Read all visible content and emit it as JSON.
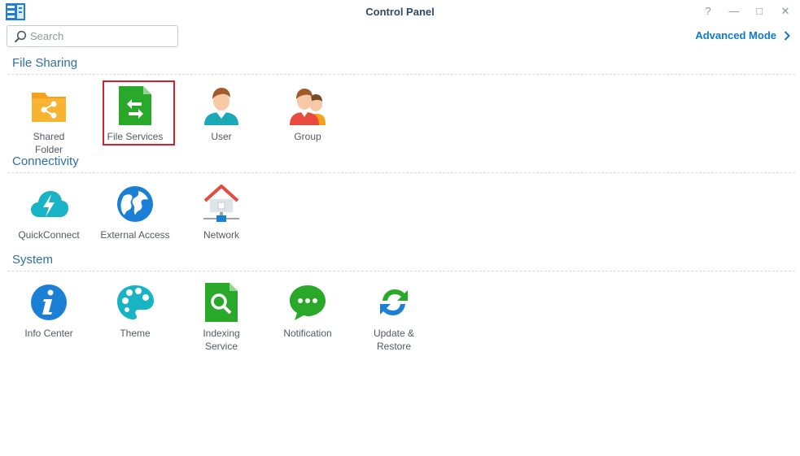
{
  "window": {
    "title": "Control Panel",
    "help_glyph": "?",
    "minimize_glyph": "—",
    "maximize_glyph": "□",
    "close_glyph": "✕"
  },
  "toolbar": {
    "search_placeholder": "Search",
    "search_value": "",
    "advanced_mode_label": "Advanced Mode"
  },
  "sections": [
    {
      "title": "File Sharing",
      "items": [
        {
          "label": "Shared\nFolder",
          "icon": "shared-folder-icon"
        },
        {
          "label": "File Services",
          "icon": "file-services-icon",
          "highlighted": true
        },
        {
          "label": "User",
          "icon": "user-icon"
        },
        {
          "label": "Group",
          "icon": "group-icon"
        }
      ]
    },
    {
      "title": "Connectivity",
      "items": [
        {
          "label": "QuickConnect",
          "icon": "quickconnect-icon"
        },
        {
          "label": "External Access",
          "icon": "external-access-icon"
        },
        {
          "label": "Network",
          "icon": "network-icon"
        }
      ]
    },
    {
      "title": "System",
      "items": [
        {
          "label": "Info Center",
          "icon": "info-center-icon"
        },
        {
          "label": "Theme",
          "icon": "theme-icon"
        },
        {
          "label": "Indexing\nService",
          "icon": "indexing-service-icon"
        },
        {
          "label": "Notification",
          "icon": "notification-icon"
        },
        {
          "label": "Update &\nRestore",
          "icon": "update-restore-icon"
        }
      ]
    }
  ],
  "colors": {
    "accent": "#0d7ad1",
    "section_title": "#2f70a4",
    "highlight_border": "#d6212a",
    "folder_orange": "#f5a11c",
    "green": "#2aa82a",
    "blue": "#1b7fd6",
    "teal": "#18b3c4",
    "network_red": "#e84a3f"
  }
}
